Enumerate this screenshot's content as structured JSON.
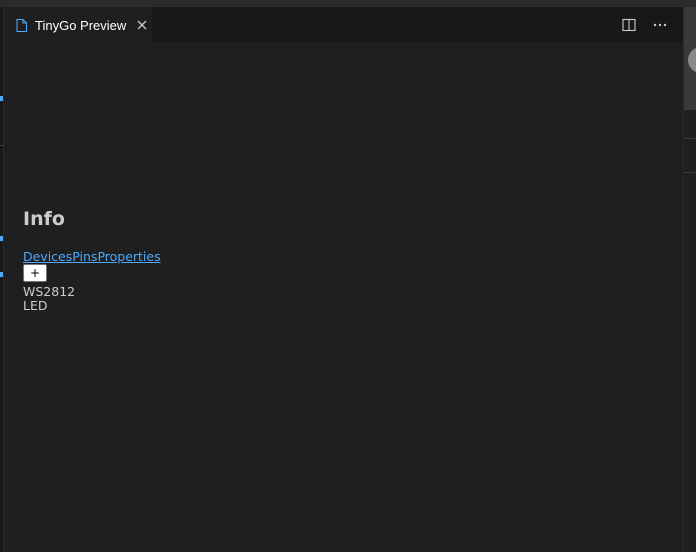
{
  "tab": {
    "label": "TinyGo Preview",
    "file_icon": "file-icon",
    "close_icon": "close-icon"
  },
  "actions": {
    "split_icon": "split-editor-icon",
    "more_icon": "more-actions-icon"
  },
  "preview": {
    "heading": "Info",
    "links": [
      "Devices",
      "Pins",
      "Properties"
    ],
    "add_button_label": "+",
    "device_lines": [
      "WS2812",
      "LED"
    ]
  },
  "colors": {
    "background": "#1f1f1f",
    "tabbar": "#181818",
    "link": "#4daafc",
    "text": "#cccccc",
    "accent": "#4daafc"
  }
}
